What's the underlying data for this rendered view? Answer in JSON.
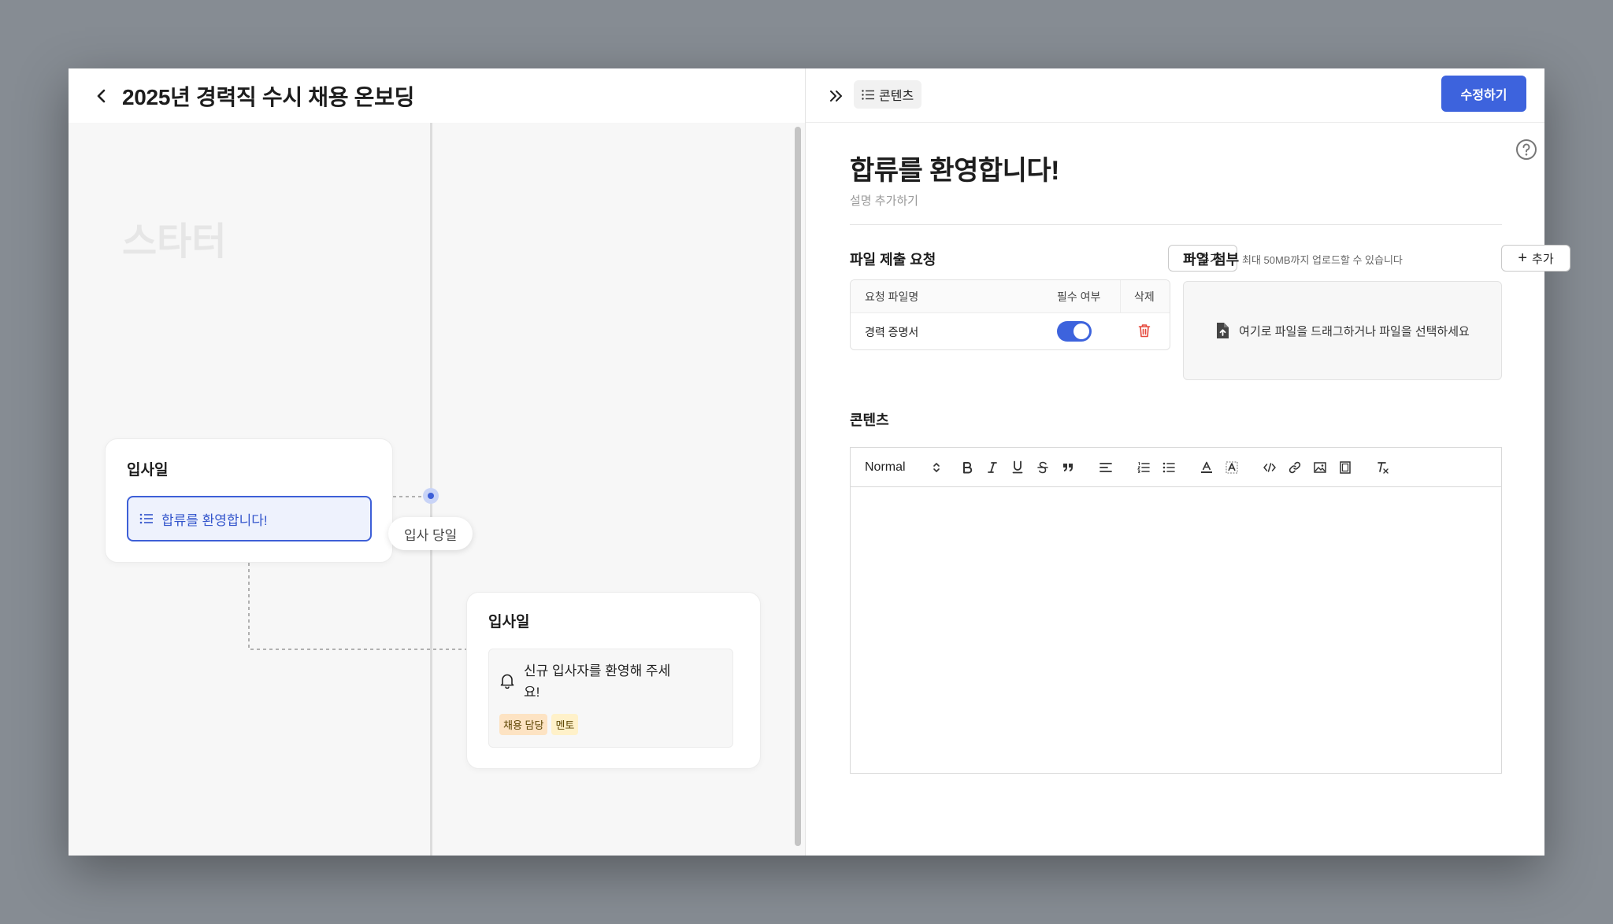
{
  "header": {
    "title": "2025년 경력직 수시 채용 온보딩"
  },
  "canvas": {
    "starter_label": "스타터",
    "day_badge": "입사 당일",
    "card1": {
      "title": "입사일",
      "item_label": "합류를 환영합니다!"
    },
    "card2": {
      "title": "입사일",
      "message": "신규 입사자를 환영해 주세요!",
      "tags": [
        "채용 담당",
        "멘토"
      ]
    }
  },
  "panel": {
    "tab_label": "콘텐츠",
    "edit_button": "수정하기",
    "title": "합류를 환영합니다!",
    "description_placeholder": "설명 추가하기",
    "file_request": {
      "title": "파일 제출 요청",
      "add_label": "추가",
      "columns": [
        "요청 파일명",
        "필수 여부",
        "삭제"
      ],
      "rows": [
        {
          "name": "경력 증명서",
          "required": true
        }
      ]
    },
    "file_attach": {
      "title": "파일 첨부",
      "note": "최대 50MB까지 업로드할 수 있습니다",
      "add_label": "추가",
      "dropzone_text": "여기로 파일을 드래그하거나 파일을 선택하세요"
    },
    "content_section": {
      "title": "콘텐츠",
      "format_select": "Normal"
    }
  },
  "colors": {
    "accent": "#3d63dd",
    "tag_orange": "#fde3c3",
    "tag_yellow": "#fff1c9",
    "delete": "#e5483c"
  }
}
